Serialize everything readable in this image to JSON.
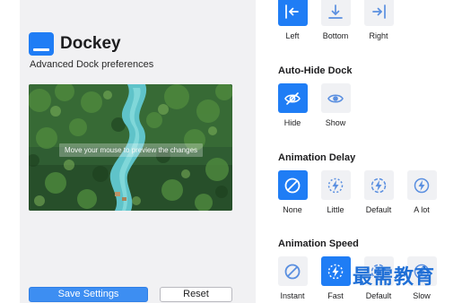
{
  "app": {
    "title": "Dockey",
    "subtitle": "Advanced Dock preferences",
    "icon": "dock-icon",
    "accent_color": "#1f7df5"
  },
  "preview": {
    "hint": "Move your mouse to preview the changes"
  },
  "buttons": {
    "save_label": "Save Settings",
    "reset_label": "Reset"
  },
  "position": {
    "options": [
      {
        "label": "Left",
        "icon": "arrow-left-bar-icon",
        "selected": true
      },
      {
        "label": "Bottom",
        "icon": "arrow-down-bar-icon",
        "selected": false
      },
      {
        "label": "Right",
        "icon": "arrow-right-bar-icon",
        "selected": false
      }
    ]
  },
  "auto_hide": {
    "title": "Auto-Hide Dock",
    "options": [
      {
        "label": "Hide",
        "icon": "eye-slash-icon",
        "selected": true
      },
      {
        "label": "Show",
        "icon": "eye-icon",
        "selected": false
      }
    ]
  },
  "animation_delay": {
    "title": "Animation Delay",
    "options": [
      {
        "label": "None",
        "icon": "no-entry-icon",
        "selected": true
      },
      {
        "label": "Little",
        "icon": "bolt-dashed-icon",
        "selected": false
      },
      {
        "label": "Default",
        "icon": "bolt-dashed-icon",
        "selected": false
      },
      {
        "label": "A lot",
        "icon": "bolt-circle-icon",
        "selected": false
      }
    ]
  },
  "animation_speed": {
    "title": "Animation Speed",
    "options": [
      {
        "label": "Instant",
        "icon": "no-entry-icon",
        "selected": false
      },
      {
        "label": "Fast",
        "icon": "bolt-dashed-icon",
        "selected": true
      },
      {
        "label": "Default",
        "icon": "bolt-dashed-icon",
        "selected": false
      },
      {
        "label": "Slow",
        "icon": "bolt-circle-icon",
        "selected": false
      }
    ]
  },
  "watermark": {
    "text": "最需教育"
  }
}
